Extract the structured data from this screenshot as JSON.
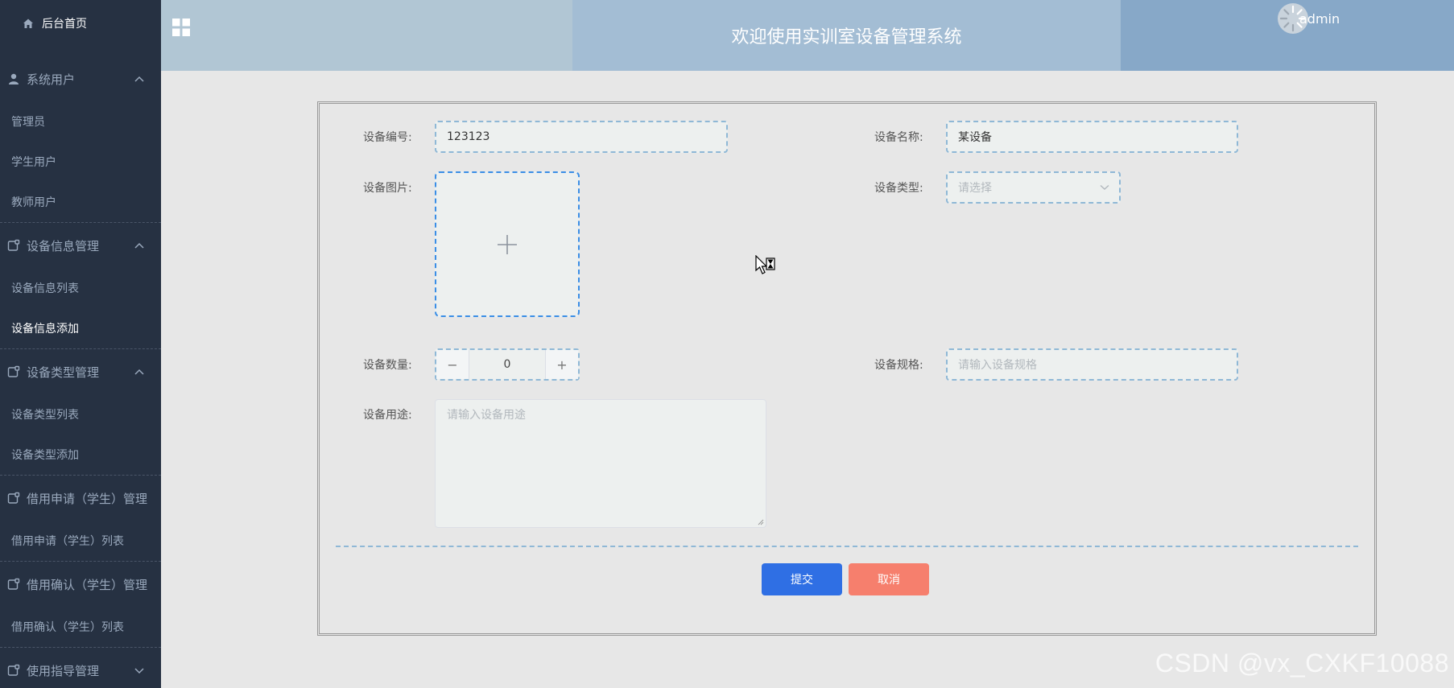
{
  "sidebar": {
    "home": "后台首页",
    "groups": [
      {
        "title": "系统用户",
        "icon": "user-icon",
        "expanded": true,
        "items": [
          "管理员",
          "学生用户",
          "教师用户"
        ]
      },
      {
        "title": "设备信息管理",
        "icon": "folder-icon",
        "expanded": true,
        "items": [
          "设备信息列表",
          "设备信息添加"
        ]
      },
      {
        "title": "设备类型管理",
        "icon": "folder-icon",
        "expanded": true,
        "items": [
          "设备类型列表",
          "设备类型添加"
        ]
      },
      {
        "title": "借用申请（学生）管理",
        "icon": "folder-icon",
        "expanded": true,
        "items": [
          "借用申请（学生）列表"
        ]
      },
      {
        "title": "借用确认（学生）管理",
        "icon": "folder-icon",
        "expanded": true,
        "items": [
          "借用确认（学生）列表"
        ]
      },
      {
        "title": "使用指导管理",
        "icon": "folder-icon",
        "expanded": false,
        "items": []
      }
    ],
    "active_item": "设备信息添加"
  },
  "header": {
    "title": "欢迎使用实训室设备管理系统",
    "username": "admin"
  },
  "form": {
    "code_label": "设备编号:",
    "code_value": "123123",
    "name_label": "设备名称:",
    "name_value": "某设备",
    "image_label": "设备图片:",
    "type_label": "设备类型:",
    "type_placeholder": "请选择",
    "qty_label": "设备数量:",
    "qty_value": "0",
    "spec_label": "设备规格:",
    "spec_placeholder": "请输入设备规格",
    "usage_label": "设备用途:",
    "usage_placeholder": "请输入设备用途",
    "submit": "提交",
    "cancel": "取消"
  },
  "watermark": "CSDN @vx_CXKF10088",
  "colors": {
    "sidebar_bg": "#263142",
    "primary": "#2f6fe4",
    "cancel": "#f67f6d"
  }
}
